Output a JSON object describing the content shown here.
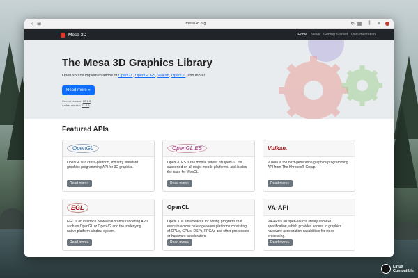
{
  "browser": {
    "url": "mesa3d.org"
  },
  "navbar": {
    "brand": "Mesa 3D",
    "links": [
      {
        "label": "Home",
        "active": true
      },
      {
        "label": "News",
        "active": false
      },
      {
        "label": "Getting Started",
        "active": false
      },
      {
        "label": "Documentation",
        "active": false
      }
    ]
  },
  "hero": {
    "title": "The Mesa 3D Graphics Library",
    "lead_prefix": "Open source implementations of ",
    "lead_links": [
      "OpenGL",
      "OpenGL ES",
      "Vulkan",
      "OpenCL"
    ],
    "lead_suffix": ", and more!",
    "button": "Read more »",
    "current_release_label": "Current release: ",
    "current_release": "22.1.3",
    "amber_release_label": "Amber release: ",
    "amber_release": "21.3.9"
  },
  "featured": {
    "heading": "Featured APIs",
    "cards": [
      {
        "logo": "OpenGL",
        "text": "OpenGL is a cross-platform, industry standard graphics programming API for 3D graphics.",
        "button": "Read more»"
      },
      {
        "logo": "OpenGL ES",
        "text": "OpenGL ES is the mobile subset of OpenGL. It's supported on all major mobile platforms, and is also the base for WebGL.",
        "button": "Read more»"
      },
      {
        "logo": "Vulkan.",
        "text": "Vulkan is the next-generation graphics programming API from The Khronos® Group.",
        "button": "Read more»"
      },
      {
        "logo": "EGL",
        "text": "EGL is an interface between Khronos rendering APIs such as OpenGL or OpenVG and the underlying native platform window system.",
        "button": "Read more»"
      },
      {
        "logo": "OpenCL",
        "text": "OpenCL is a framework for writing programs that execute across heterogeneous platforms consisting of CPUs, GPUs, DSPs, FPGAs and other processors or hardware accelerators.",
        "button": "Read more»"
      },
      {
        "logo": "VA-API",
        "text": "VA-API is an open-source library and API specification, which provides access to graphics hardware acceleration capabilities for video processing.",
        "button": "Read more»"
      }
    ]
  },
  "badge": {
    "line1": "Linux",
    "line2": "Compatible"
  },
  "colors": {
    "primary": "#0d6efd",
    "navbar": "#212529",
    "hero_bg": "#e9ecef",
    "secondary_btn": "#6c757d"
  }
}
